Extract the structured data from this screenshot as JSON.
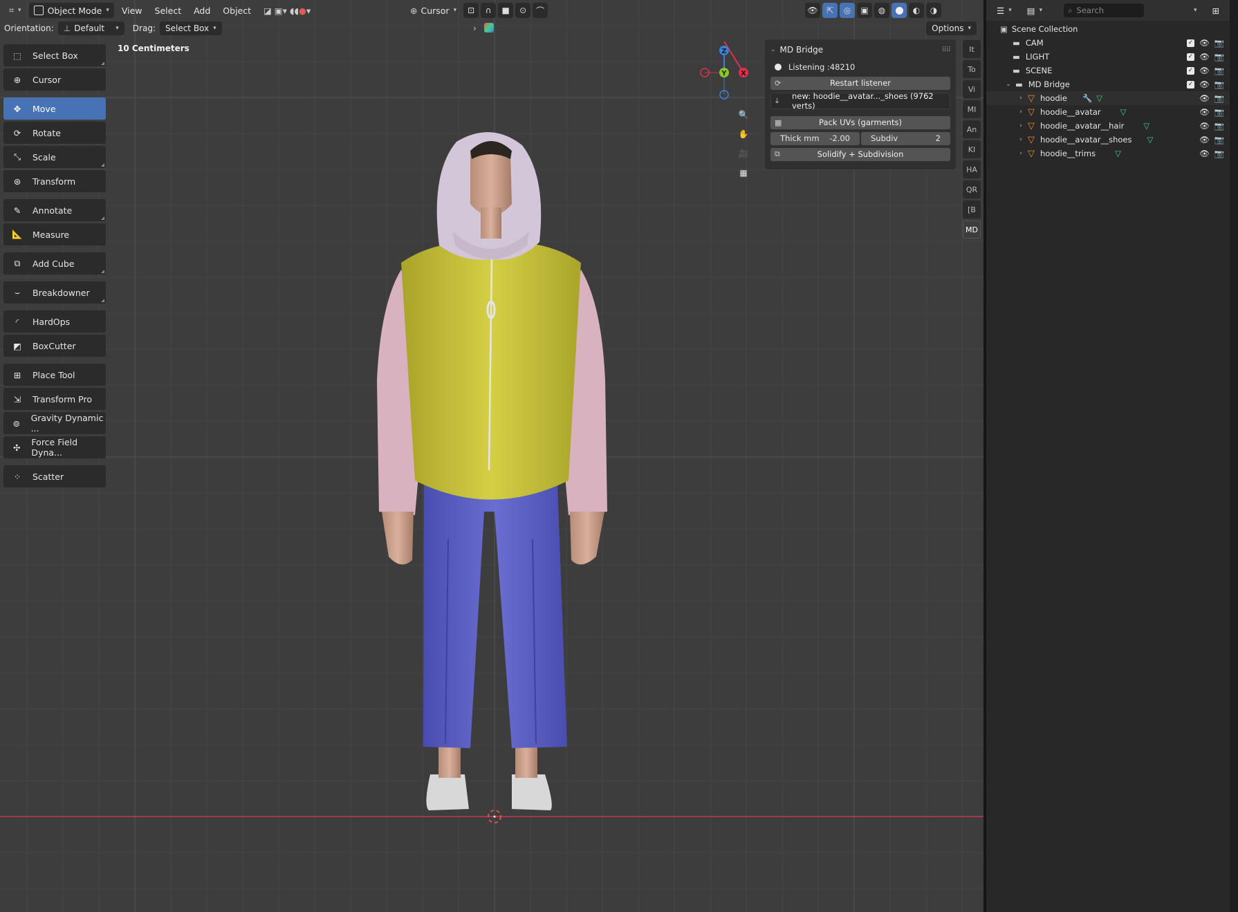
{
  "header": {
    "mode": "Object Mode",
    "menus": [
      "View",
      "Select",
      "Add",
      "Object"
    ],
    "pivot": "Cursor"
  },
  "tool_settings": {
    "orientation_label": "Orientation:",
    "orientation_value": "Default",
    "drag_label": "Drag:",
    "drag_value": "Select Box",
    "options": "Options"
  },
  "viewport": {
    "unit_label": "10 Centimeters"
  },
  "toolbar": {
    "tools": [
      "Select Box",
      "Cursor",
      "Move",
      "Rotate",
      "Scale",
      "Transform",
      "Annotate",
      "Measure",
      "Add Cube",
      "Breakdowner",
      "HardOps",
      "BoxCutter",
      "Place Tool",
      "Transform Pro",
      "Gravity Dynamic ...",
      "Force Field Dyna...",
      "Scatter"
    ],
    "active": "Move"
  },
  "gizmo": {
    "z": "Z",
    "y": "Y",
    "x": "X"
  },
  "md_bridge": {
    "title": "MD Bridge",
    "listening": "Listening :48210",
    "restart": "Restart listener",
    "import_info": "new: hoodie__avatar..._shoes (9762 verts)",
    "pack_uvs": "Pack UVs (garments)",
    "thick_label": "Thick mm",
    "thick_value": "-2.00",
    "subdiv_label": "Subdiv",
    "subdiv_value": "2",
    "solidify": "Solidify + Subdivision"
  },
  "side_tabs": [
    "It",
    "To",
    "Vi",
    "MI",
    "An",
    "KI",
    "HA",
    "QR",
    "[B",
    "MD"
  ],
  "outliner": {
    "search_placeholder": "Search",
    "root": "Scene Collection",
    "collections": [
      "CAM",
      "LIGHT",
      "SCENE",
      "MD Bridge"
    ],
    "objects": [
      "hoodie",
      "hoodie__avatar",
      "hoodie__avatar__hair",
      "hoodie__avatar__shoes",
      "hoodie__trims"
    ]
  },
  "colors": {
    "accent": "#4772b3",
    "hoodie_body": "#c9c43a",
    "sleeves": "#d9b2c0",
    "hood": "#d3c6d8",
    "pants": "#5e61c4",
    "axis_x": "#e0314a",
    "axis_y": "#8cc62d",
    "axis_z": "#3b82d6",
    "mesh_icon": "#e88a2e",
    "data_icon": "#3fcf8e"
  }
}
